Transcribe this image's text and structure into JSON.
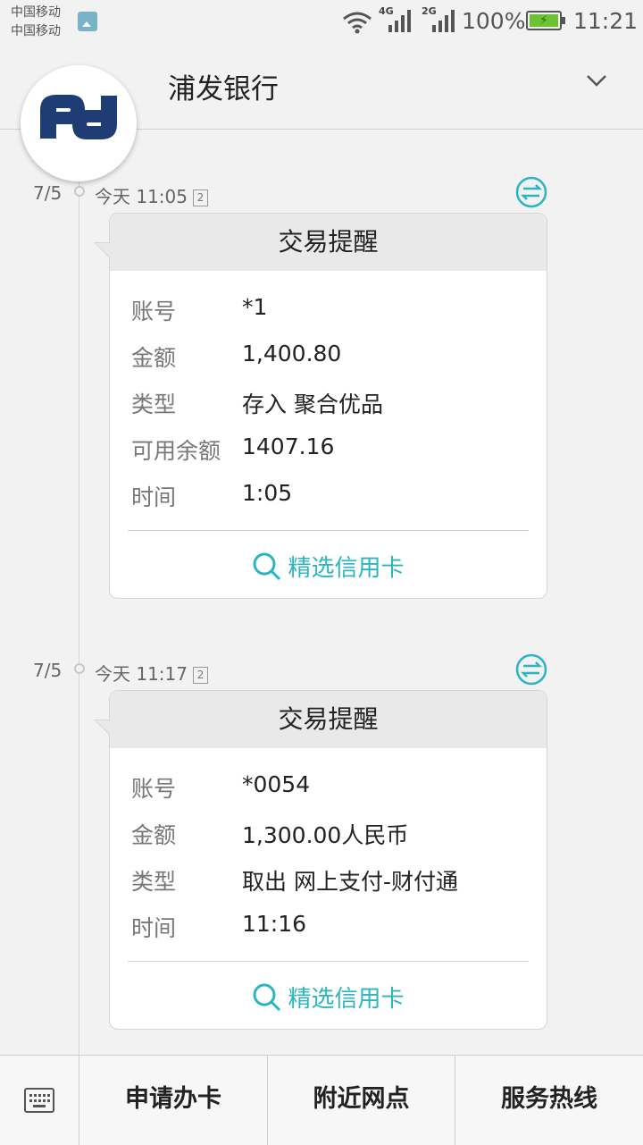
{
  "status_bar": {
    "carrier_1": "中国移动",
    "carrier_2": "中国移动",
    "net_1": "4G",
    "net_2": "2G",
    "battery": "100%",
    "time": "11:21"
  },
  "header": {
    "title": "浦发银行",
    "avatar_text": "pd"
  },
  "messages": [
    {
      "date": "7/5",
      "timestamp": "今天 11:05",
      "sim": "2",
      "card_title": "交易提醒",
      "rows": [
        {
          "label": "账号",
          "value": "*1"
        },
        {
          "label": "金额",
          "value": "1,400.80"
        },
        {
          "label": "类型",
          "value": "存入 聚合优品"
        },
        {
          "label": "可用余额",
          "value": "1407.16"
        },
        {
          "label": "时间",
          "value": "1:05"
        }
      ],
      "link": "精选信用卡"
    },
    {
      "date": "7/5",
      "timestamp": "今天 11:17",
      "sim": "2",
      "card_title": "交易提醒",
      "rows": [
        {
          "label": "账号",
          "value": "*0054"
        },
        {
          "label": "金额",
          "value": "1,300.00人民币"
        },
        {
          "label": "类型",
          "value": "取出 网上支付-财付通"
        },
        {
          "label": "时间",
          "value": "11:16"
        }
      ],
      "link": "精选信用卡"
    }
  ],
  "bottom_menu": {
    "apply_card": "申请办卡",
    "nearby_branch": "附近网点",
    "service_hotline": "服务热线"
  },
  "colors": {
    "accent": "#2bb5c2",
    "brand": "#1e3d75",
    "battery": "#6cc233"
  }
}
